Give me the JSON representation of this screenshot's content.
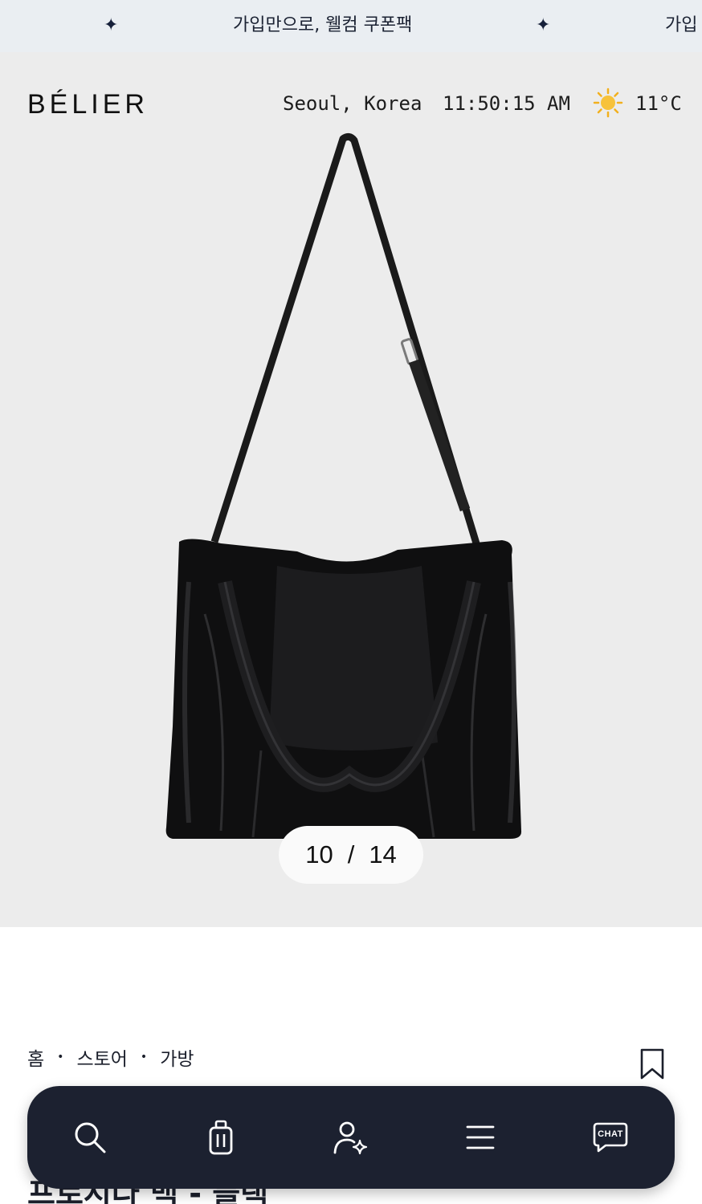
{
  "promo": {
    "text": "가입만으로, 웰컴 쿠폰팩",
    "text_repeat": "가입",
    "star_icon": "sparkle-icon"
  },
  "header": {
    "logo": "BÉLIER",
    "location": "Seoul, Korea",
    "time": "11:50:15 AM",
    "weather_icon": "sun-icon",
    "temperature": "11°C"
  },
  "gallery": {
    "current": "10",
    "separator": "/",
    "total": "14"
  },
  "breadcrumb": {
    "items": [
      "홈",
      "스토어",
      "가방"
    ],
    "separator": "•"
  },
  "product": {
    "title": "프로시다 백 - 블랙"
  },
  "bottom_nav": {
    "items": [
      {
        "icon": "search-icon"
      },
      {
        "icon": "luggage-icon"
      },
      {
        "icon": "user-sparkle-icon"
      },
      {
        "icon": "menu-icon"
      },
      {
        "icon": "chat-icon",
        "label": "CHAT"
      }
    ]
  },
  "colors": {
    "nav_background": "#1c2130",
    "promo_background": "#eaeef2",
    "hero_background": "#ececec"
  }
}
